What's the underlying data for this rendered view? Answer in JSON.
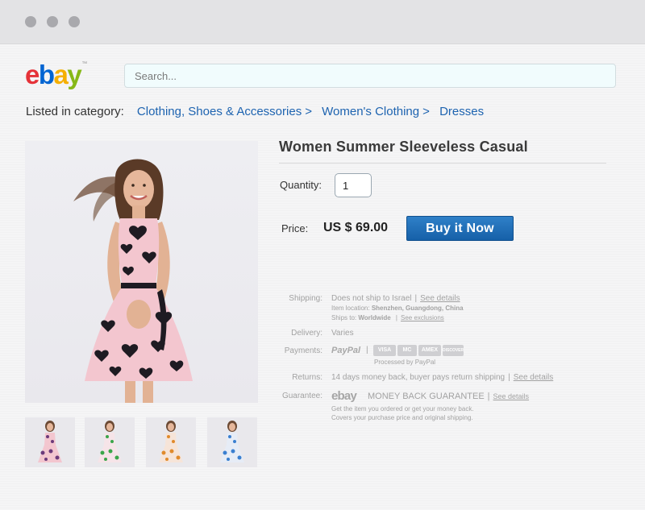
{
  "search": {
    "placeholder": "Search..."
  },
  "breadcrumb": {
    "label": "Listed in category:",
    "items": [
      "Clothing, Shoes & Accessories",
      "Women's Clothing",
      "Dresses"
    ],
    "separator": ">"
  },
  "product": {
    "title": "Women Summer Sleeveless Casual",
    "quantity_label": "Quantity:",
    "quantity_value": "1",
    "price_label": "Price:",
    "price_value": "US $ 69.00",
    "buy_label": "Buy it Now"
  },
  "details": {
    "shipping_label": "Shipping:",
    "shipping_value": "Does not ship to Israel",
    "shipping_see": "See details",
    "item_location_label": "Item location:",
    "item_location_value": "Shenzhen, Guangdong, China",
    "ships_to_label": "Ships to:",
    "ships_to_value": "Worldwide",
    "ships_to_see": "See exclusions",
    "delivery_label": "Delivery:",
    "delivery_value": "Varies",
    "payments_label": "Payments:",
    "paypal_text": "PayPal",
    "cards": [
      "VISA",
      "MC",
      "AMEX",
      "DISCOVER"
    ],
    "processed_text": "Processed by PayPal",
    "returns_label": "Returns:",
    "returns_value": "14 days money back, buyer pays return shipping",
    "returns_see": "See details",
    "guarantee_label": "Guarantee:",
    "guarantee_logo": "ebay",
    "guarantee_title": "MONEY BACK GUARANTEE",
    "guarantee_see": "See details",
    "guarantee_line1": "Get the item you ordered or get your money back.",
    "guarantee_line2": "Covers your purchase price and original shipping."
  },
  "thumbnails": [
    {
      "name": "thumb-pink",
      "color": "#6c3a7a"
    },
    {
      "name": "thumb-green",
      "color": "#3aa64a"
    },
    {
      "name": "thumb-orange",
      "color": "#e08a2c"
    },
    {
      "name": "thumb-blue",
      "color": "#3a7fd0"
    }
  ],
  "colors": {
    "link": "#1d63b0",
    "button": "#1f6ab8",
    "dress": "#f3c6cf",
    "heart": "#1e1b22"
  }
}
